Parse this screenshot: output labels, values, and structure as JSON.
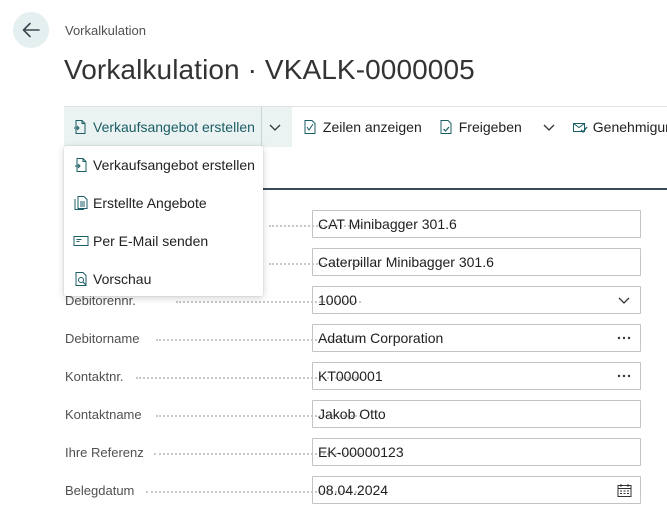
{
  "header": {
    "breadcrumb": "Vorkalkulation",
    "title": "Vorkalkulation · VKALK-0000005"
  },
  "actions": {
    "create_quote": "Verkaufsangebot erstellen",
    "show_lines": "Zeilen anzeigen",
    "release": "Freigeben",
    "approval": "Genehmigung"
  },
  "dropdown": {
    "items": [
      {
        "label": "Verkaufsangebot erstellen",
        "icon": "create-document-icon"
      },
      {
        "label": "Erstellte Angebote",
        "icon": "documents-list-icon"
      },
      {
        "label": "Per E-Mail senden",
        "icon": "email-icon"
      },
      {
        "label": "Vorschau",
        "icon": "preview-icon"
      }
    ]
  },
  "fields": {
    "description": {
      "label": "",
      "value": "CAT Minibagger 301.6"
    },
    "description2": {
      "label": "",
      "value": "Caterpillar Minibagger 301.6"
    },
    "customer_no": {
      "label": "Debitorennr.",
      "value": "10000"
    },
    "customer_name": {
      "label": "Debitorname",
      "value": "Adatum Corporation"
    },
    "contact_no": {
      "label": "Kontaktnr.",
      "value": "KT000001"
    },
    "contact_name": {
      "label": "Kontaktname",
      "value": "Jakob Otto"
    },
    "your_reference": {
      "label": "Ihre Referenz",
      "value": "EK-00000123"
    },
    "document_date": {
      "label": "Belegdatum",
      "value": "08.04.2024"
    }
  },
  "colors": {
    "accent": "#1b5e64",
    "accent_bg": "#eaf2f2",
    "tab_underline": "#3a4b55"
  }
}
